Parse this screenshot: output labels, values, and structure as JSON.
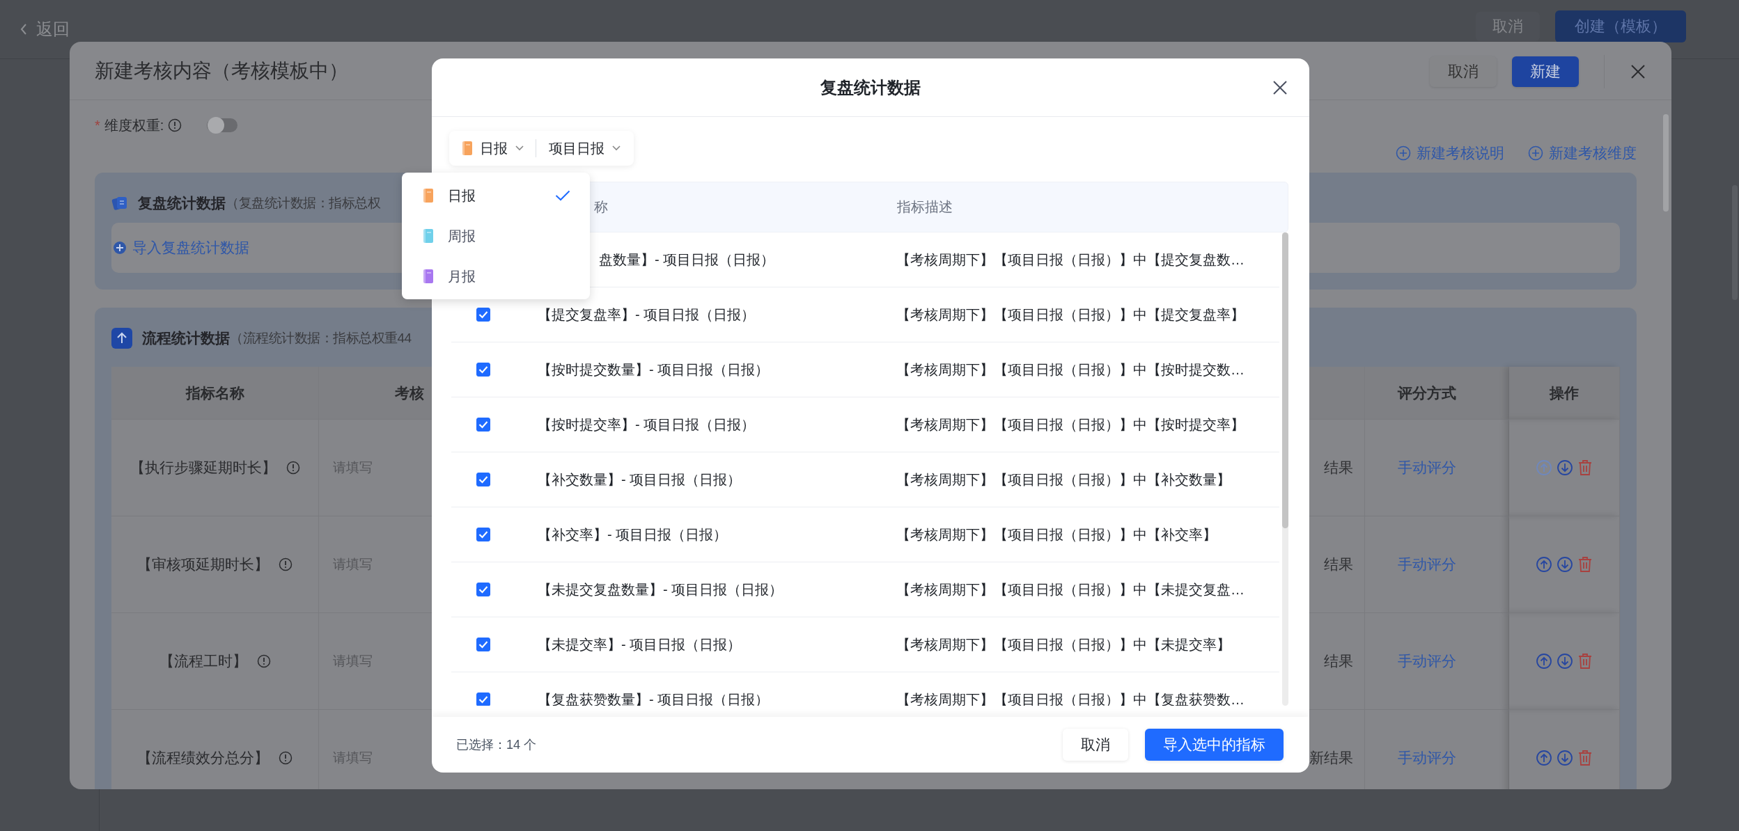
{
  "page": {
    "back": "返回",
    "buttons": [
      {
        "label": "取消",
        "kind": "default"
      },
      {
        "label": "创建（模板）",
        "kind": "primary"
      }
    ]
  },
  "dialog": {
    "title": "新建考核内容（考核模板中）",
    "buttons": [
      {
        "label": "取消",
        "kind": "default"
      },
      {
        "label": "新建",
        "kind": "primary"
      }
    ],
    "weight": {
      "required_mark": "*",
      "label": "维度权重:",
      "on": false
    },
    "links": [
      "新建考核说明",
      "新建考核维度"
    ],
    "sections": [
      {
        "kind": "review",
        "title": "复盘统计数据",
        "subtitle": "（复盘统计数据：指标总权",
        "action": "导入复盘统计数据"
      },
      {
        "kind": "flow",
        "title": "流程统计数据",
        "subtitle": "（流程统计数据：指标总权重44",
        "table": {
          "columns": [
            "指标名称",
            "考核",
            "评分方式",
            "操作"
          ],
          "rows": [
            {
              "name": "【执行步骤延期时长】",
              "placeholder": "请填写",
              "result": "结果",
              "scoring": "手动评分",
              "up_disabled": true
            },
            {
              "name": "【审核项延期时长】",
              "placeholder": "请填写",
              "result": "结果",
              "scoring": "手动评分",
              "up_disabled": false
            },
            {
              "name": "【流程工时】",
              "placeholder": "请填写",
              "result": "结果",
              "scoring": "手动评分",
              "up_disabled": false
            },
            {
              "name": "【流程绩效分总分】",
              "placeholder": "请填写",
              "result": "新结果",
              "scoring": "手动评分",
              "up_disabled": false
            }
          ]
        }
      }
    ]
  },
  "modal": {
    "title": "复盘统计数据",
    "filters": [
      {
        "label": "日报",
        "kind": "period"
      },
      {
        "label": "项目日报",
        "kind": "report"
      }
    ],
    "columns": [
      "称",
      "指标描述"
    ],
    "rows": [
      {
        "name": "盘数量】- 项目日报（日报）",
        "description": "【考核周期下】【项目日报（日报）】中【提交复盘数…"
      },
      {
        "checked": true,
        "name": "【提交复盘率】- 项目日报（日报）",
        "description": "【考核周期下】【项目日报（日报）】中【提交复盘率】"
      },
      {
        "checked": true,
        "name": "【按时提交数量】- 项目日报（日报）",
        "description": "【考核周期下】【项目日报（日报）】中【按时提交数…"
      },
      {
        "checked": true,
        "name": "【按时提交率】- 项目日报（日报）",
        "description": "【考核周期下】【项目日报（日报）】中【按时提交率】"
      },
      {
        "checked": true,
        "name": "【补交数量】- 项目日报（日报）",
        "description": "【考核周期下】【项目日报（日报）】中【补交数量】"
      },
      {
        "checked": true,
        "name": "【补交率】- 项目日报（日报）",
        "description": "【考核周期下】【项目日报（日报）】中【补交率】"
      },
      {
        "checked": true,
        "name": "【未提交复盘数量】- 项目日报（日报）",
        "description": "【考核周期下】【项目日报（日报）】中【未提交复盘…"
      },
      {
        "checked": true,
        "name": "【未提交率】- 项目日报（日报）",
        "description": "【考核周期下】【项目日报（日报）】中【未提交率】"
      },
      {
        "checked": true,
        "name": "【复盘获赞数量】- 项目日报（日报）",
        "description": "【考核周期下】【项目日报（日报）】中【复盘获赞数…"
      }
    ],
    "selected_count": "已选择：14 个",
    "buttons": [
      {
        "label": "取消",
        "kind": "default"
      },
      {
        "label": "导入选中的指标",
        "kind": "primary"
      }
    ]
  },
  "dropdown": {
    "items": [
      {
        "label": "日报",
        "color": "#f7a35c",
        "selected": true
      },
      {
        "label": "周报",
        "color": "#6fd0ea",
        "selected": false
      },
      {
        "label": "月报",
        "color": "#a877f0",
        "selected": false
      }
    ]
  }
}
